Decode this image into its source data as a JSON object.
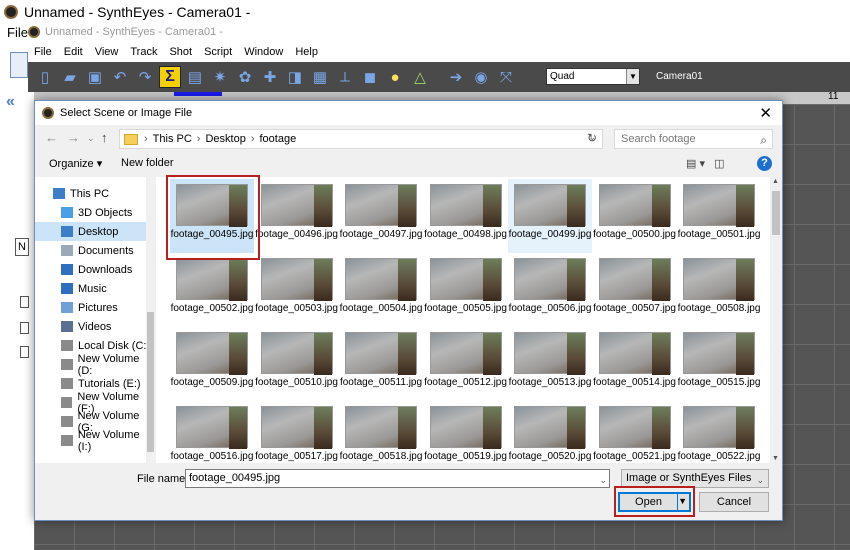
{
  "app": {
    "title": "Unnamed - SynthEyes - Camera01 -",
    "inner_title": "Unnamed - SynthEyes - Camera01 -",
    "file_menu": "File",
    "menus": [
      "File",
      "Edit",
      "View",
      "Track",
      "Shot",
      "Script",
      "Window",
      "Help"
    ],
    "view_select": "Quad",
    "camera_label": "Camera01",
    "timeline_tick": "11",
    "side_label": "N"
  },
  "dialog": {
    "title": "Select Scene or Image File",
    "breadcrumb": [
      "This PC",
      "Desktop",
      "footage"
    ],
    "search_placeholder": "Search footage",
    "organize_label": "Organize ▾",
    "new_folder_label": "New folder",
    "nav_items": [
      {
        "label": "This PC",
        "icon": "computer-icon",
        "color": "#3c7fc8"
      },
      {
        "label": "3D Objects",
        "icon": "cube-icon",
        "color": "#4aa0e8"
      },
      {
        "label": "Desktop",
        "icon": "desktop-icon",
        "color": "#3c7fc8"
      },
      {
        "label": "Documents",
        "icon": "document-icon",
        "color": "#9aa8b8"
      },
      {
        "label": "Downloads",
        "icon": "download-icon",
        "color": "#2f6fc0"
      },
      {
        "label": "Music",
        "icon": "music-icon",
        "color": "#2f6fc0"
      },
      {
        "label": "Pictures",
        "icon": "picture-icon",
        "color": "#6fa0d8"
      },
      {
        "label": "Videos",
        "icon": "video-icon",
        "color": "#5a7090"
      },
      {
        "label": "Local Disk (C:)",
        "icon": "drive-icon",
        "color": "#8a8a8a"
      },
      {
        "label": "New Volume (D:",
        "icon": "drive-icon",
        "color": "#8a8a8a"
      },
      {
        "label": "Tutorials (E:)",
        "icon": "drive-icon",
        "color": "#8a8a8a"
      },
      {
        "label": "New Volume (F:)",
        "icon": "drive-icon",
        "color": "#8a8a8a"
      },
      {
        "label": "New Volume (G:",
        "icon": "drive-icon",
        "color": "#8a8a8a"
      },
      {
        "label": "New Volume (I:)",
        "icon": "drive-icon",
        "color": "#8a8a8a"
      }
    ],
    "selected_nav": "Desktop",
    "files": [
      "footage_00495.jpg",
      "footage_00496.jpg",
      "footage_00497.jpg",
      "footage_00498.jpg",
      "footage_00499.jpg",
      "footage_00500.jpg",
      "footage_00501.jpg",
      "footage_00502.jpg",
      "footage_00503.jpg",
      "footage_00504.jpg",
      "footage_00505.jpg",
      "footage_00506.jpg",
      "footage_00507.jpg",
      "footage_00508.jpg",
      "footage_00509.jpg",
      "footage_00510.jpg",
      "footage_00511.jpg",
      "footage_00512.jpg",
      "footage_00513.jpg",
      "footage_00514.jpg",
      "footage_00515.jpg",
      "footage_00516.jpg",
      "footage_00517.jpg",
      "footage_00518.jpg",
      "footage_00519.jpg",
      "footage_00520.jpg",
      "footage_00521.jpg",
      "footage_00522.jpg"
    ],
    "selected_file": "footage_00495.jpg",
    "hover_file": "footage_00499.jpg",
    "file_name_label": "File name:",
    "file_name_value": "footage_00495.jpg",
    "file_type": "Image or SynthEyes Files",
    "open_label": "Open",
    "cancel_label": "Cancel"
  },
  "colors": {
    "highlight_frame": "#b82020",
    "selection": "#cce4f7",
    "accent": "#0078d7"
  }
}
